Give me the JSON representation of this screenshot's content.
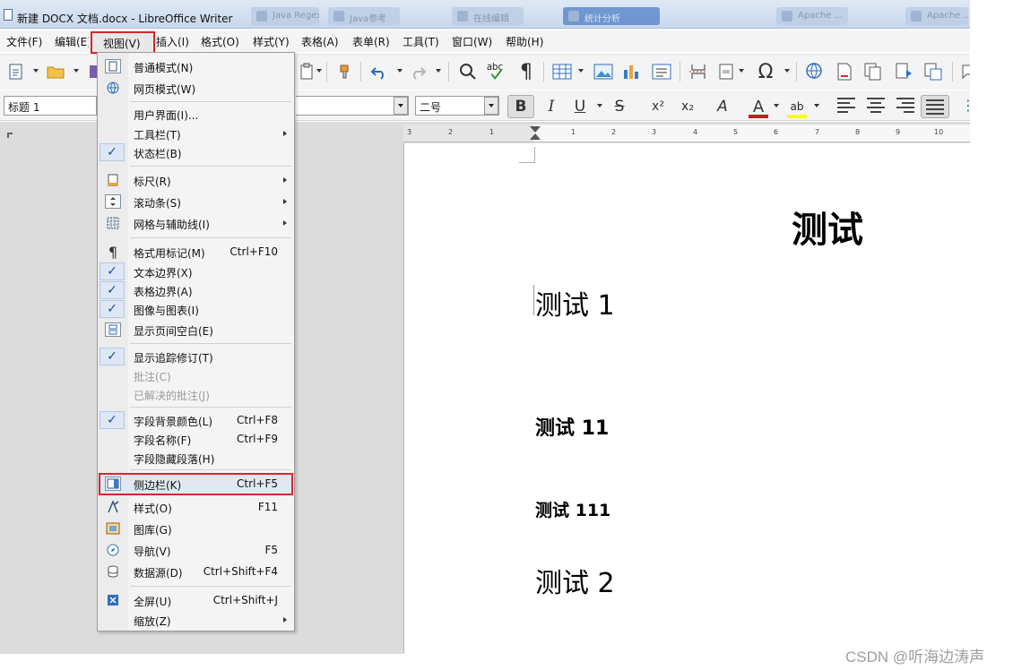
{
  "window": {
    "title": "新建 DOCX 文档.docx - LibreOffice Writer",
    "background_tabs": [
      "Java Regex",
      "Java参考",
      "在线编辑",
      "统计分析",
      "Apache ...",
      "Apache ..."
    ]
  },
  "menubar": {
    "items": [
      "文件(F)",
      "编辑(E)",
      "视图(V)",
      "插入(I)",
      "格式(O)",
      "样式(Y)",
      "表格(A)",
      "表单(R)",
      "工具(T)",
      "窗口(W)",
      "帮助(H)"
    ],
    "open_item": "视图(V)"
  },
  "toolbar2": {
    "paragraph_style": "标题 1",
    "font_size": "二号"
  },
  "ruler": {
    "labels": [
      "3",
      "2",
      "1",
      "1",
      "2",
      "3",
      "4",
      "5",
      "6",
      "7",
      "8",
      "9",
      "10"
    ]
  },
  "view_menu": {
    "items": [
      {
        "label": "普通模式(N)",
        "icon": "normal-view-icon"
      },
      {
        "label": "网页模式(W)",
        "icon": "web-view-icon"
      },
      {
        "label": "用户界面(I)..."
      },
      {
        "label": "工具栏(T)",
        "submenu": true
      },
      {
        "label": "状态栏(B)",
        "checked": true
      },
      {
        "label": "标尺(R)",
        "icon": "ruler-icon",
        "submenu": true
      },
      {
        "label": "滚动条(S)",
        "icon": "scrollbar-icon",
        "submenu": true
      },
      {
        "label": "网格与辅助线(I)",
        "icon": "grid-icon",
        "submenu": true
      },
      {
        "label": "格式用标记(M)",
        "icon": "pilcrow-icon",
        "shortcut": "Ctrl+F10"
      },
      {
        "label": "文本边界(X)",
        "checked": true
      },
      {
        "label": "表格边界(A)",
        "checked": true
      },
      {
        "label": "图像与图表(I)",
        "checked": true
      },
      {
        "label": "显示页间空白(E)",
        "icon": "page-spacing-icon"
      },
      {
        "label": "显示追踪修订(T)",
        "checked": true
      },
      {
        "label": "批注(C)",
        "disabled": true
      },
      {
        "label": "已解决的批注(J)",
        "disabled": true
      },
      {
        "label": "字段背景颜色(L)",
        "checked": true,
        "shortcut": "Ctrl+F8"
      },
      {
        "label": "字段名称(F)",
        "shortcut": "Ctrl+F9"
      },
      {
        "label": "字段隐藏段落(H)"
      },
      {
        "label": "侧边栏(K)",
        "icon": "sidebar-icon",
        "shortcut": "Ctrl+F5",
        "highlighted": true
      },
      {
        "label": "样式(O)",
        "icon": "styles-icon",
        "shortcut": "F11"
      },
      {
        "label": "图库(G)",
        "icon": "gallery-icon"
      },
      {
        "label": "导航(V)",
        "icon": "navigator-icon",
        "shortcut": "F5"
      },
      {
        "label": "数据源(D)",
        "icon": "data-source-icon",
        "shortcut": "Ctrl+Shift+F4"
      },
      {
        "label": "全屏(U)",
        "icon": "fullscreen-icon",
        "shortcut": "Ctrl+Shift+J"
      },
      {
        "label": "缩放(Z)",
        "submenu": true
      }
    ]
  },
  "document": {
    "lines": [
      "测试",
      "测试 1",
      "测试 11",
      "测试 111",
      "测试 2"
    ]
  },
  "watermark": "CSDN @听海边涛声",
  "colors": {
    "highlight_red": "#d8262c",
    "check_blue": "#174f9e",
    "font_color_red": "#d0191a",
    "highlight_yellow": "#ffff00"
  }
}
